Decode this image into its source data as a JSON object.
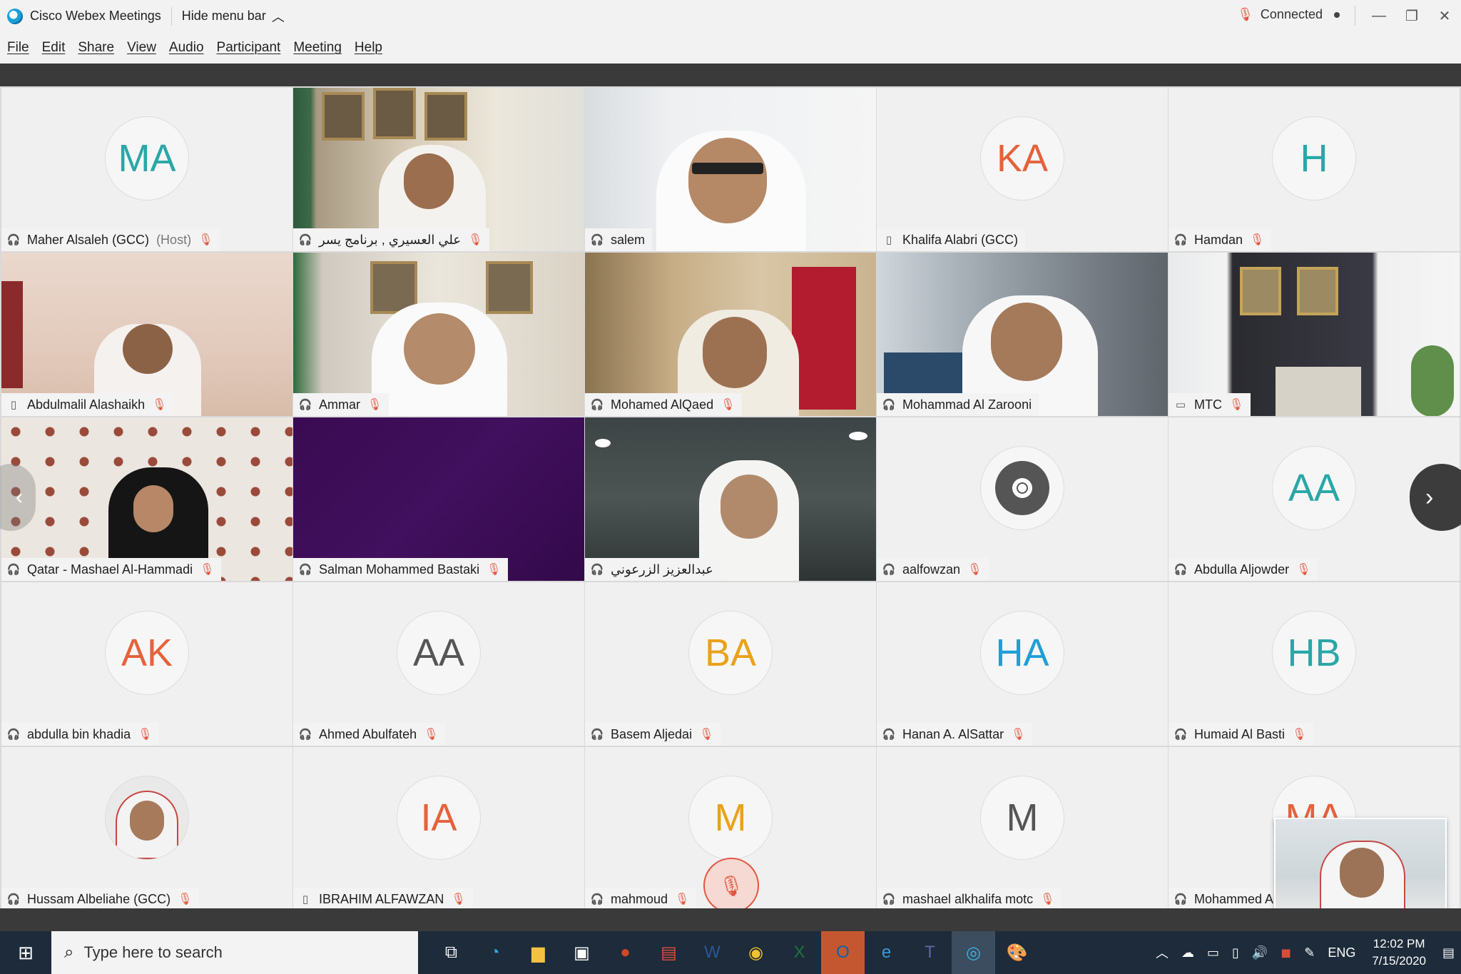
{
  "window": {
    "title": "Cisco Webex Meetings",
    "hide_menu": "Hide menu bar",
    "status": "Connected"
  },
  "menu": [
    "File",
    "Edit",
    "Share",
    "View",
    "Audio",
    "Participant",
    "Meeting",
    "Help"
  ],
  "participants": [
    {
      "name": "Maher Alsaleh (GCC)",
      "host": "(Host)",
      "initials": "MA"
    },
    {
      "name": "علي العسيري , برنامج يسر"
    },
    {
      "name": "salem"
    },
    {
      "name": "Khalifa Alabri (GCC)",
      "initials": "KA"
    },
    {
      "name": "Hamdan",
      "initials": "H"
    },
    {
      "name": "Abdulmalil Alashaikh"
    },
    {
      "name": "Ammar"
    },
    {
      "name": "Mohamed AlQaed"
    },
    {
      "name": "Mohammad Al Zarooni"
    },
    {
      "name": "MTC"
    },
    {
      "name": "Qatar - Mashael Al-Hammadi"
    },
    {
      "name": "Salman Mohammed Bastaki"
    },
    {
      "name": "عبدالعزيز الزرعوني"
    },
    {
      "name": "aalfowzan"
    },
    {
      "name": "Abdulla Aljowder",
      "initials": "AA"
    },
    {
      "name": "abdulla bin khadia",
      "initials": "AK"
    },
    {
      "name": "Ahmed Abulfateh",
      "initials": "AA"
    },
    {
      "name": "Basem Aljedai",
      "initials": "BA"
    },
    {
      "name": "Hanan A. AlSattar",
      "initials": "HA"
    },
    {
      "name": "Humaid Al Basti",
      "initials": "HB"
    },
    {
      "name": "Hussam Albeliahe (GCC)"
    },
    {
      "name": "IBRAHIM ALFAWZAN",
      "initials": "IA"
    },
    {
      "name": "mahmoud",
      "initials": "M"
    },
    {
      "name": "mashael alkhalifa motc",
      "initials": "M"
    },
    {
      "name": "Mohammed A",
      "initials": "MA"
    }
  ],
  "taskbar": {
    "search_placeholder": "Type here to search",
    "lang": "ENG",
    "time": "12:02 PM",
    "date": "7/15/2020"
  }
}
